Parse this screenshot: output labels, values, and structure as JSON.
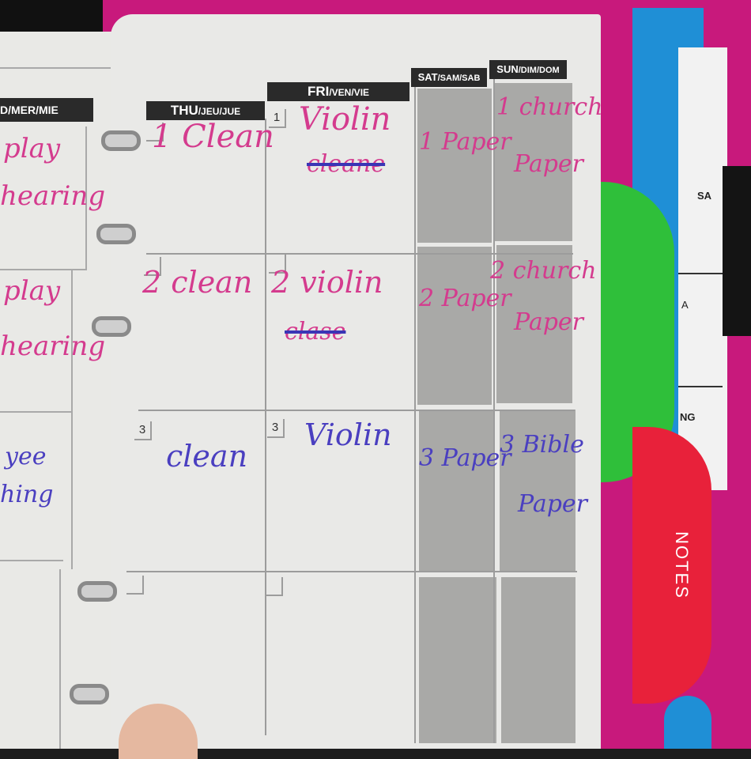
{
  "left_page": {
    "header": "D/MER/MIE",
    "entries": [
      {
        "text": "play",
        "color": "#d43b8e"
      },
      {
        "text": "hearing",
        "color": "#d43b8e"
      },
      {
        "text": "play",
        "color": "#d43b8e"
      },
      {
        "text": "hearing",
        "color": "#d43b8e"
      },
      {
        "text": "yee",
        "color": "#4a3fc0"
      },
      {
        "text": "hing",
        "color": "#4a3fc0"
      }
    ]
  },
  "headers": {
    "thu": {
      "main": "THU",
      "rest": "/JEU/JUE"
    },
    "fri": {
      "main": "FRI",
      "rest": "/VEN/VIE"
    },
    "sat": {
      "main": "SAT",
      "rest": "/SAM/SAB"
    },
    "sun": {
      "main": "SUN",
      "rest": "/DIM/DOM"
    }
  },
  "rows": [
    {
      "thu_date": "",
      "thu": "1 Clean",
      "fri_date": "1",
      "fri": "Violin",
      "fri_crossed": "cleane",
      "sat": "1 Paper",
      "sun": "1 church",
      "sun2": "Paper"
    },
    {
      "thu_date": "",
      "thu": "2 clean",
      "fri_date": "",
      "fri": "2 violin",
      "fri_crossed": "clase",
      "sat": "2 Paper",
      "sun": "2 church",
      "sun2": "Paper"
    },
    {
      "thu_date": "3",
      "thu": "clean",
      "fri_date": "3",
      "fri": "Violin",
      "fri_crossed": "",
      "sat": "3 Paper",
      "sun": "3 Bible",
      "sun2": "Paper"
    }
  ],
  "tabs": {
    "notes": "NOTES",
    "sa": "SA",
    "a": "A",
    "ng": "NG"
  }
}
